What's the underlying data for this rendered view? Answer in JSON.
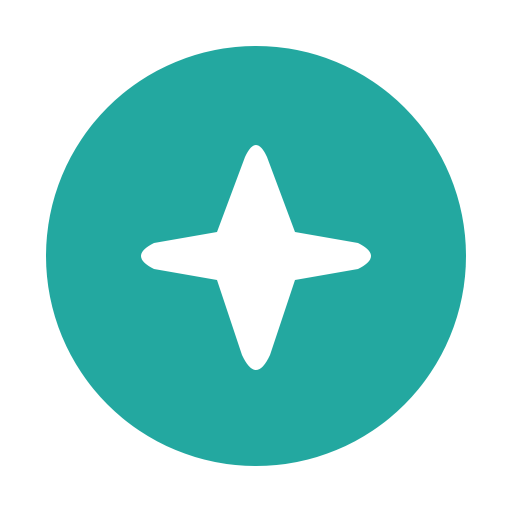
{
  "icon": {
    "name": "sparkle-icon",
    "background_shape": "circle",
    "glyph": "four-point-star",
    "colors": {
      "circle": "#23A8A0",
      "glyph": "#FFFFFF",
      "page_background": "#FFFFFF"
    }
  }
}
